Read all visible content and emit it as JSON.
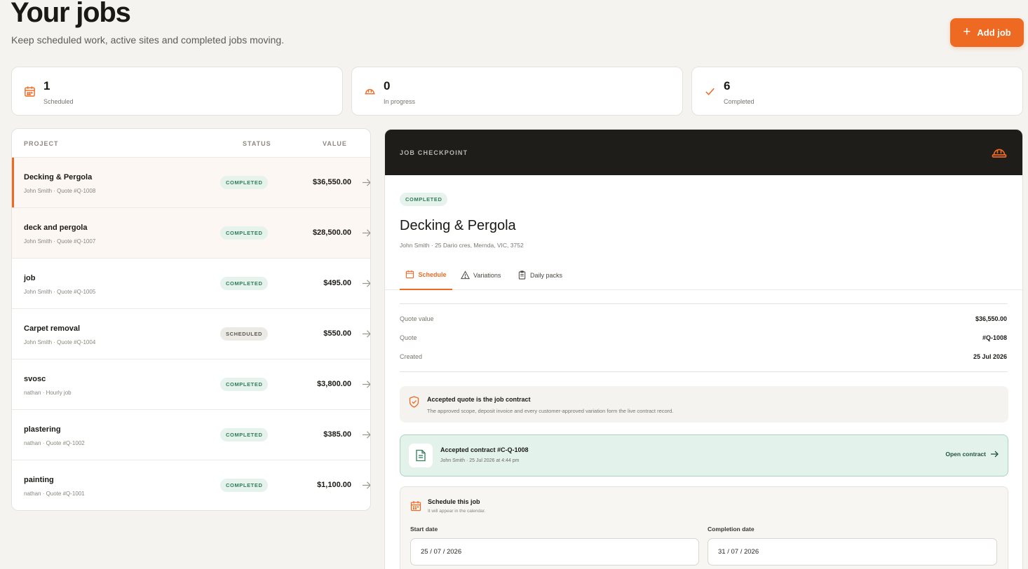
{
  "header": {
    "title": "Your jobs",
    "subtitle": "Keep scheduled work, active sites and completed jobs moving.",
    "add_job_label": "Add job"
  },
  "stats": [
    {
      "value": "1",
      "label": "Scheduled",
      "icon": "calendar-icon"
    },
    {
      "value": "0",
      "label": "In progress",
      "icon": "hard-hat-icon"
    },
    {
      "value": "6",
      "label": "Completed",
      "icon": "check-icon"
    }
  ],
  "jobs_table": {
    "columns": {
      "project": "PROJECT",
      "status": "STATUS",
      "value": "VALUE"
    },
    "rows": [
      {
        "name": "Decking & Pergola",
        "meta": "John Smith · Quote #Q-1008",
        "status": "COMPLETED",
        "value": "$36,550.00"
      },
      {
        "name": "deck and pergola",
        "meta": "John Smith · Quote #Q-1007",
        "status": "COMPLETED",
        "value": "$28,500.00"
      },
      {
        "name": "job",
        "meta": "John Smith · Quote #Q-1005",
        "status": "COMPLETED",
        "value": "$495.00"
      },
      {
        "name": "Carpet removal",
        "meta": "John Smith · Quote #Q-1004",
        "status": "SCHEDULED",
        "value": "$550.00"
      },
      {
        "name": "svosc",
        "meta": "nathan · Hourly job",
        "status": "COMPLETED",
        "value": "$3,800.00"
      },
      {
        "name": "plastering",
        "meta": "nathan · Quote #Q-1002",
        "status": "COMPLETED",
        "value": "$385.00"
      },
      {
        "name": "painting",
        "meta": "nathan · Quote #Q-1001",
        "status": "COMPLETED",
        "value": "$1,100.00"
      }
    ]
  },
  "detail": {
    "eyebrow": "JOB CHECKPOINT",
    "status": "COMPLETED",
    "title": "Decking & Pergola",
    "subtitle": "John Smith · 25 Dario cres, Mernda, VIC, 3752",
    "tabs": {
      "schedule": "Schedule",
      "variations": "Variations",
      "daily_packs": "Daily packs"
    },
    "summary": {
      "quote_value_label": "Quote value",
      "quote_value": "$36,550.00",
      "quote_label": "Quote",
      "quote": "#Q-1008",
      "created_label": "Created",
      "created": "25 Jul 2026"
    },
    "notice": {
      "title": "Accepted quote is the job contract",
      "text": "The approved scope, deposit invoice and every customer-approved variation form the live contract record."
    },
    "contract": {
      "title": "Accepted contract #C-Q-1008",
      "meta": "John Smith · 25 Jul 2026 at 4:44 pm",
      "open_label": "Open contract"
    },
    "schedule": {
      "title": "Schedule this job",
      "subtitle": "It will appear in the calendar.",
      "start_label": "Start date",
      "start_value": "25 / 07 / 2026",
      "end_label": "Completion date",
      "end_value": "31 / 07 / 2026"
    }
  },
  "colors": {
    "accent": "#ee6a23",
    "dark": "#1e1d1a",
    "success_bg": "#e5f3ec",
    "success_text": "#2f7c5a"
  }
}
